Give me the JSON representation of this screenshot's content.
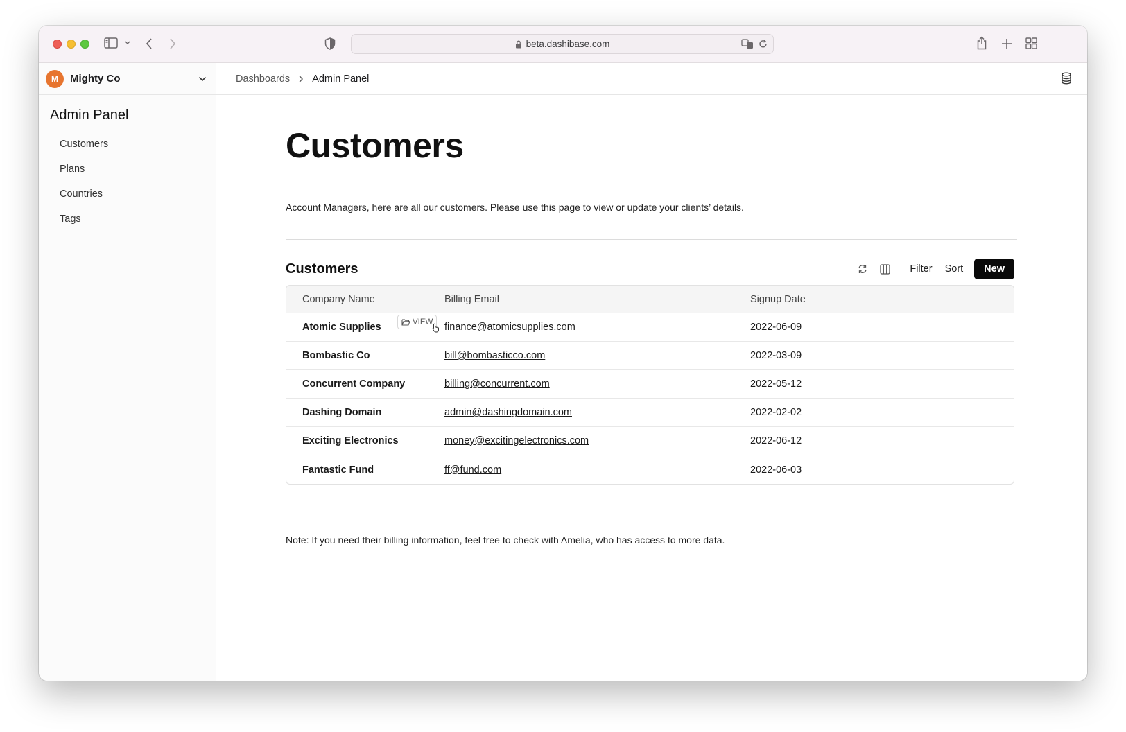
{
  "browser": {
    "url": "beta.dashibase.com"
  },
  "sidebar": {
    "workspace_initial": "M",
    "workspace_name": "Mighty Co",
    "panel_title": "Admin Panel",
    "items": [
      {
        "label": "Customers"
      },
      {
        "label": "Plans"
      },
      {
        "label": "Countries"
      },
      {
        "label": "Tags"
      }
    ]
  },
  "breadcrumb": {
    "parent": "Dashboards",
    "current": "Admin Panel"
  },
  "page": {
    "title": "Customers",
    "description": "Account Managers, here are all our customers. Please use this page to view or update your clients’ details.",
    "note": "Note: If you need their billing information, feel free to check with Amelia, who has access to more data."
  },
  "table_section": {
    "title": "Customers",
    "filter_label": "Filter",
    "sort_label": "Sort",
    "new_label": "New",
    "view_label": "VIEW",
    "columns": [
      "Company Name",
      "Billing Email",
      "Signup Date"
    ],
    "rows": [
      {
        "company": "Atomic Supplies",
        "email": "finance@atomicsupplies.com",
        "date": "2022-06-09"
      },
      {
        "company": "Bombastic Co",
        "email": "bill@bombasticco.com",
        "date": "2022-03-09"
      },
      {
        "company": "Concurrent Company",
        "email": "billing@concurrent.com",
        "date": "2022-05-12"
      },
      {
        "company": "Dashing Domain",
        "email": "admin@dashingdomain.com",
        "date": "2022-02-02"
      },
      {
        "company": "Exciting Electronics",
        "email": "money@excitingelectronics.com",
        "date": "2022-06-12"
      },
      {
        "company": "Fantastic Fund",
        "email": "ff@fund.com",
        "date": "2022-06-03"
      }
    ]
  }
}
